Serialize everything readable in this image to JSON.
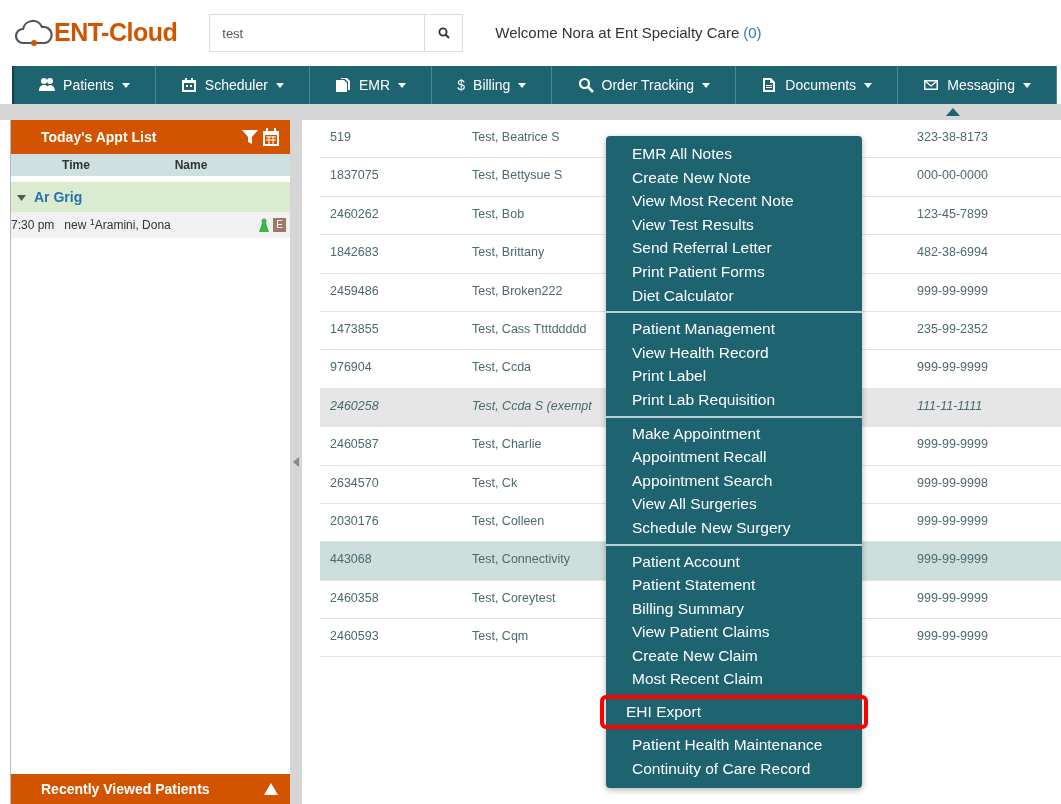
{
  "header": {
    "logo": "ENT-Cloud",
    "search": {
      "value": "test"
    },
    "welcome": "Welcome Nora at Ent Specialty Care",
    "message_count": "(0)"
  },
  "nav": [
    {
      "label": "Patients",
      "kind": "people"
    },
    {
      "label": "Scheduler",
      "kind": "calendar"
    },
    {
      "label": "EMR",
      "kind": "files"
    },
    {
      "label": "Billing",
      "kind": "dollar",
      "symbol": "$"
    },
    {
      "label": "Order Tracking",
      "kind": "search"
    },
    {
      "label": "Documents",
      "kind": "document"
    },
    {
      "label": "Messaging",
      "kind": "envelope"
    }
  ],
  "appt_panel": {
    "title": "Today's Appt List",
    "columns": [
      "Time",
      "Name"
    ],
    "groups": [
      {
        "name": "Ar Grig",
        "expanded": true,
        "appointments": [
          {
            "time": "7:30 pm",
            "type": "new",
            "mark": "1",
            "name": "Aramini, Dona",
            "badge": "E"
          }
        ]
      }
    ],
    "footer": "Recently Viewed Patients"
  },
  "table": {
    "rows": [
      {
        "id": "519",
        "name": "Test, Beatrice S",
        "ssn": "323-38-8173",
        "selected": false,
        "inactive": false
      },
      {
        "id": "1837075",
        "name": "Test, Bettysue S",
        "ssn": "000-00-0000",
        "selected": false,
        "inactive": false
      },
      {
        "id": "2460262",
        "name": "Test, Bob",
        "ssn": "123-45-7899",
        "selected": false,
        "inactive": false
      },
      {
        "id": "1842683",
        "name": "Test, Brittany",
        "ssn": "482-38-6994",
        "selected": false,
        "inactive": false
      },
      {
        "id": "2459486",
        "name": "Test, Broken222",
        "ssn": "999-99-9999",
        "selected": false,
        "inactive": false
      },
      {
        "id": "1473855",
        "name": "Test, Cass Ttttddddd",
        "ssn": "235-99-2352",
        "selected": false,
        "inactive": false
      },
      {
        "id": "976904",
        "name": "Test, Ccda",
        "ssn": "999-99-9999",
        "selected": false,
        "inactive": false
      },
      {
        "id": "2460258",
        "name": "Test, Ccda S (exempt",
        "ssn": "111-11-1111",
        "selected": false,
        "inactive": true
      },
      {
        "id": "2460587",
        "name": "Test, Charlie",
        "ssn": "999-99-9999",
        "selected": false,
        "inactive": false
      },
      {
        "id": "2634570",
        "name": "Test, Ck",
        "ssn": "999-99-9998",
        "selected": false,
        "inactive": false
      },
      {
        "id": "2030176",
        "name": "Test, Colleen",
        "ssn": "999-99-9999",
        "selected": false,
        "inactive": false
      },
      {
        "id": "443068",
        "name": "Test, Connectivity",
        "ssn": "999-99-9999",
        "selected": true,
        "inactive": false
      },
      {
        "id": "2460358",
        "name": "Test, Coreytest",
        "ssn": "999-99-9999",
        "selected": false,
        "inactive": false
      },
      {
        "id": "2460593",
        "name": "Test, Cqm",
        "ssn": "999-99-9999",
        "selected": false,
        "inactive": false
      }
    ]
  },
  "menu": {
    "groups": [
      [
        {
          "label": "EMR All Notes",
          "highlighted": false
        },
        {
          "label": "Create New Note",
          "highlighted": false
        },
        {
          "label": "View Most Recent Note",
          "highlighted": false
        },
        {
          "label": "View Test Results",
          "highlighted": false
        },
        {
          "label": "Send Referral Letter",
          "highlighted": false
        },
        {
          "label": "Print Patient Forms",
          "highlighted": false
        },
        {
          "label": "Diet Calculator",
          "highlighted": false
        }
      ],
      [
        {
          "label": "Patient Management",
          "highlighted": false
        },
        {
          "label": "View Health Record",
          "highlighted": false
        },
        {
          "label": "Print Label",
          "highlighted": false
        },
        {
          "label": "Print Lab Requisition",
          "highlighted": false
        }
      ],
      [
        {
          "label": "Make Appointment",
          "highlighted": false
        },
        {
          "label": "Appointment Recall",
          "highlighted": false
        },
        {
          "label": "Appointment Search",
          "highlighted": false
        },
        {
          "label": "View All Surgeries",
          "highlighted": false
        },
        {
          "label": "Schedule New Surgery",
          "highlighted": false
        }
      ],
      [
        {
          "label": "Patient Account",
          "highlighted": false
        },
        {
          "label": "Patient Statement",
          "highlighted": false
        },
        {
          "label": "Billing Summary",
          "highlighted": false
        },
        {
          "label": "View Patient Claims",
          "highlighted": false
        },
        {
          "label": "Create New Claim",
          "highlighted": false
        },
        {
          "label": "Most Recent Claim",
          "highlighted": false
        },
        {
          "label": "EHI Export",
          "highlighted": true
        },
        {
          "label": "Patient Health Maintenance",
          "highlighted": false
        },
        {
          "label": "Continuity of Care Record",
          "highlighted": false
        }
      ]
    ]
  }
}
